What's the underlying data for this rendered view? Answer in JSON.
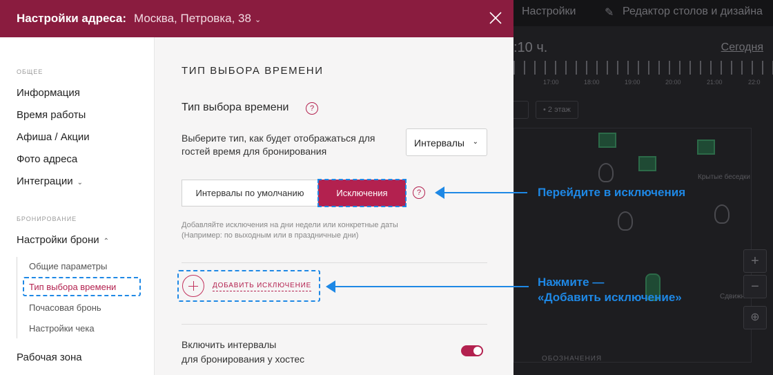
{
  "background": {
    "settings_label": "Настройки",
    "editor_label": "Редактор столов и дизайна",
    "time_fragment": ":10 ч.",
    "today": "Сегодня",
    "hours": [
      "17:00",
      "18:00",
      "19:00",
      "20:00",
      "21:00",
      "22:0"
    ],
    "floor_chip": "2 этаж",
    "zone_label": "Крытые беседки",
    "zone_label_2": "Сдвижн",
    "bottom_label": "ОБОЗНАЧЕНИЯ",
    "zoom_in": "+",
    "zoom_out": "−"
  },
  "header": {
    "title": "Настройки адреса:",
    "address": "Москва, Петровка, 38"
  },
  "sidebar": {
    "section_general": "ОБЩЕЕ",
    "items_general": [
      "Информация",
      "Время работы",
      "Афиша / Акции",
      "Фото адреса",
      "Интеграции"
    ],
    "section_booking": "БРОНИРОВАНИЕ",
    "booking_settings": "Настройки брони",
    "sub_items": [
      "Общие параметры",
      "Тип выбора времени",
      "Почасовая бронь",
      "Настройки чека"
    ],
    "active_sub": "Тип выбора времени",
    "workzone": "Рабочая зона"
  },
  "content": {
    "page_title": "ТИП ВЫБОРА ВРЕМЕНИ",
    "section_title": "Тип выбора времени",
    "help_glyph": "?",
    "description": "Выберите тип, как будет отображаться для гостей время для бронирования",
    "select_value": "Интервалы",
    "segment_default": "Интервалы по умолчанию",
    "segment_exceptions": "Исключения",
    "hint_line1": "Добавляйте исключения на дни недели или конкретные даты",
    "hint_line2": "(Например: по выходным или в праздничные дни)",
    "add_exception": "ДОБАВИТЬ ИСКЛЮЧЕНИЕ",
    "toggle_label_line1": "Включить интервалы",
    "toggle_label_line2": "для бронирования у хостес",
    "toggle_on": true
  },
  "annotations": {
    "go_to_exceptions": "Перейдите в исключения",
    "press_line1": "Нажмите —",
    "press_line2": "«Добавить исключение»"
  },
  "colors": {
    "brand": "#8a1c3f",
    "accent": "#b3214f",
    "annotation": "#1e88e5"
  }
}
